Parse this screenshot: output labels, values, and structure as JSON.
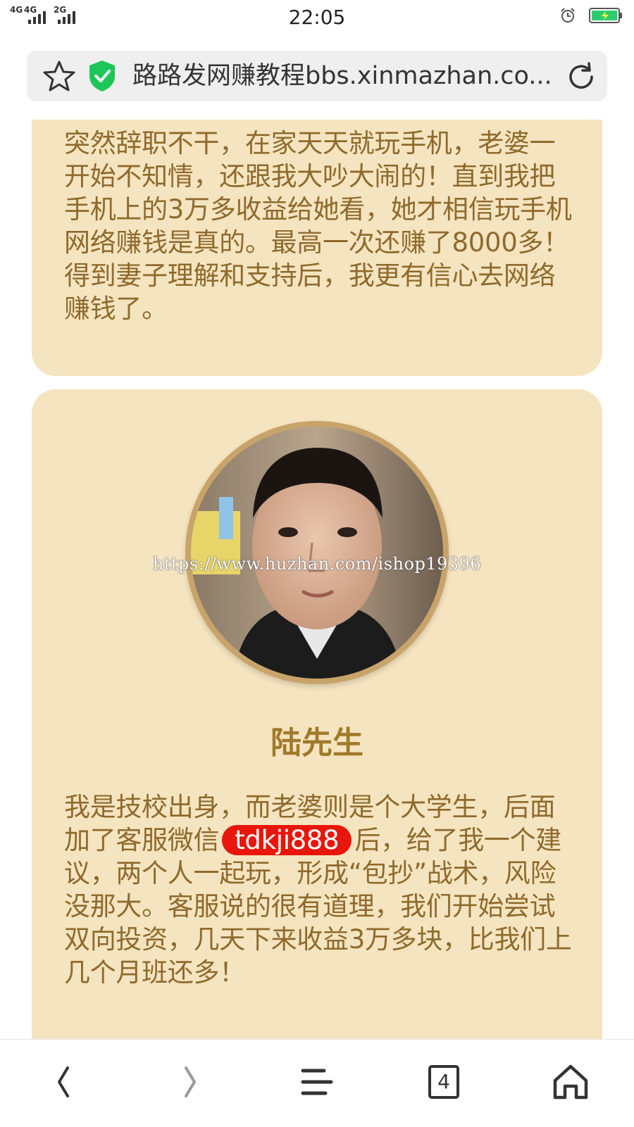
{
  "status_bar": {
    "signal_1": "4G",
    "signal_2": "4G",
    "signal_3": "2G",
    "time": "22:05",
    "icons": [
      "alarm-icon",
      "battery-charging-icon"
    ],
    "battery_color": "#2ecc71"
  },
  "address_bar": {
    "url_text": "路路发网赚教程bbs.xinmazhan.co...",
    "icons": [
      "star-icon",
      "security-shield-icon",
      "reload-icon"
    ],
    "shield_color": "#1ec65a"
  },
  "cards": [
    {
      "text": "突然辞职不干，在家天天就玩手机，老婆一开始不知情，还跟我大吵大闹的！直到我把手机上的3万多收益给她看，她才相信玩手机网络赚钱是真的。最高一次还赚了8000多！得到妻子理解和支持后，我更有信心去网络赚钱了。"
    },
    {
      "watermark": "https://www.huzhan.com/ishop19396",
      "name": "陆先生",
      "text_before": "我是技校出身，而老婆则是个大学生，后面加了客服微信",
      "wechat_id": "tdkji888",
      "text_after": "后，给了我一个建议，两个人一起玩，形成“包抄”战术，风险没那大。客服说的很有道理，我们开始尝试双向投资，几天下来收益3万多块，比我们上几个月班还多！"
    }
  ],
  "colors": {
    "card_bg": "#f5e4c0",
    "text": "#8f6a2c",
    "highlight_bg": "#e8160b"
  },
  "nav": {
    "tab_count": "4",
    "icons": [
      "back-arrow-icon",
      "forward-arrow-icon",
      "menu-icon",
      "tabs-icon",
      "home-icon"
    ]
  }
}
